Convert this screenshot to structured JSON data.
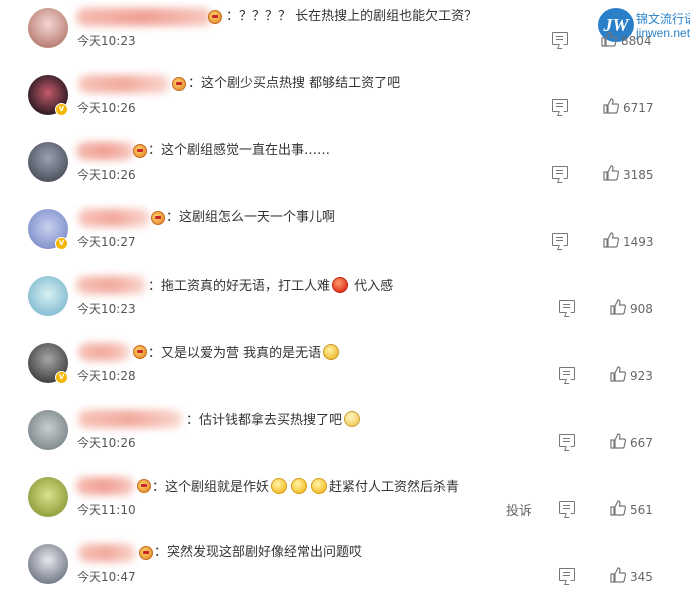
{
  "watermark": {
    "logo": "JW",
    "cn": "锦文流行语",
    "url": "jinwen.net"
  },
  "colors": {
    "text": "#333333",
    "meta": "#555555",
    "icon": "#777777",
    "watermark": "#2980c9"
  },
  "comments": [
    {
      "text": "：？？？？ 长在热搜上的剧组也能欠工资？",
      "time": "今天10:23",
      "likes": "8804",
      "report": "",
      "verified": false
    },
    {
      "text": "：这个剧少买点热搜 都够结工资了吧",
      "time": "今天10:26",
      "likes": "6717",
      "report": "",
      "verified": true
    },
    {
      "text": "：这个剧组感觉一直在出事……",
      "time": "今天10:26",
      "likes": "3185",
      "report": "",
      "verified": false
    },
    {
      "text": "：这剧组怎么一天一个事儿啊",
      "time": "今天10:27",
      "likes": "1493",
      "report": "",
      "verified": true
    },
    {
      "text_a": "：拖工资真的好无语，打工人难",
      "text_b": " 代入感",
      "time": "今天10:23",
      "likes": "908",
      "report": "",
      "verified": false
    },
    {
      "text_a": "：又是以爱为营 我真的是无语",
      "time": "今天10:28",
      "likes": "923",
      "report": "",
      "verified": true
    },
    {
      "text_a": "：估计钱都拿去买热搜了吧",
      "time": "今天10:26",
      "likes": "667",
      "report": "",
      "verified": false
    },
    {
      "text_a": "：这个剧组就是作妖",
      "text_b": "赶紧付人工资然后杀青",
      "time": "今天11:10",
      "likes": "561",
      "report": "投诉",
      "verified": false
    },
    {
      "text": "：突然发现这部剧好像经常出问题哎",
      "time": "今天10:47",
      "likes": "345",
      "report": "",
      "verified": false
    }
  ]
}
